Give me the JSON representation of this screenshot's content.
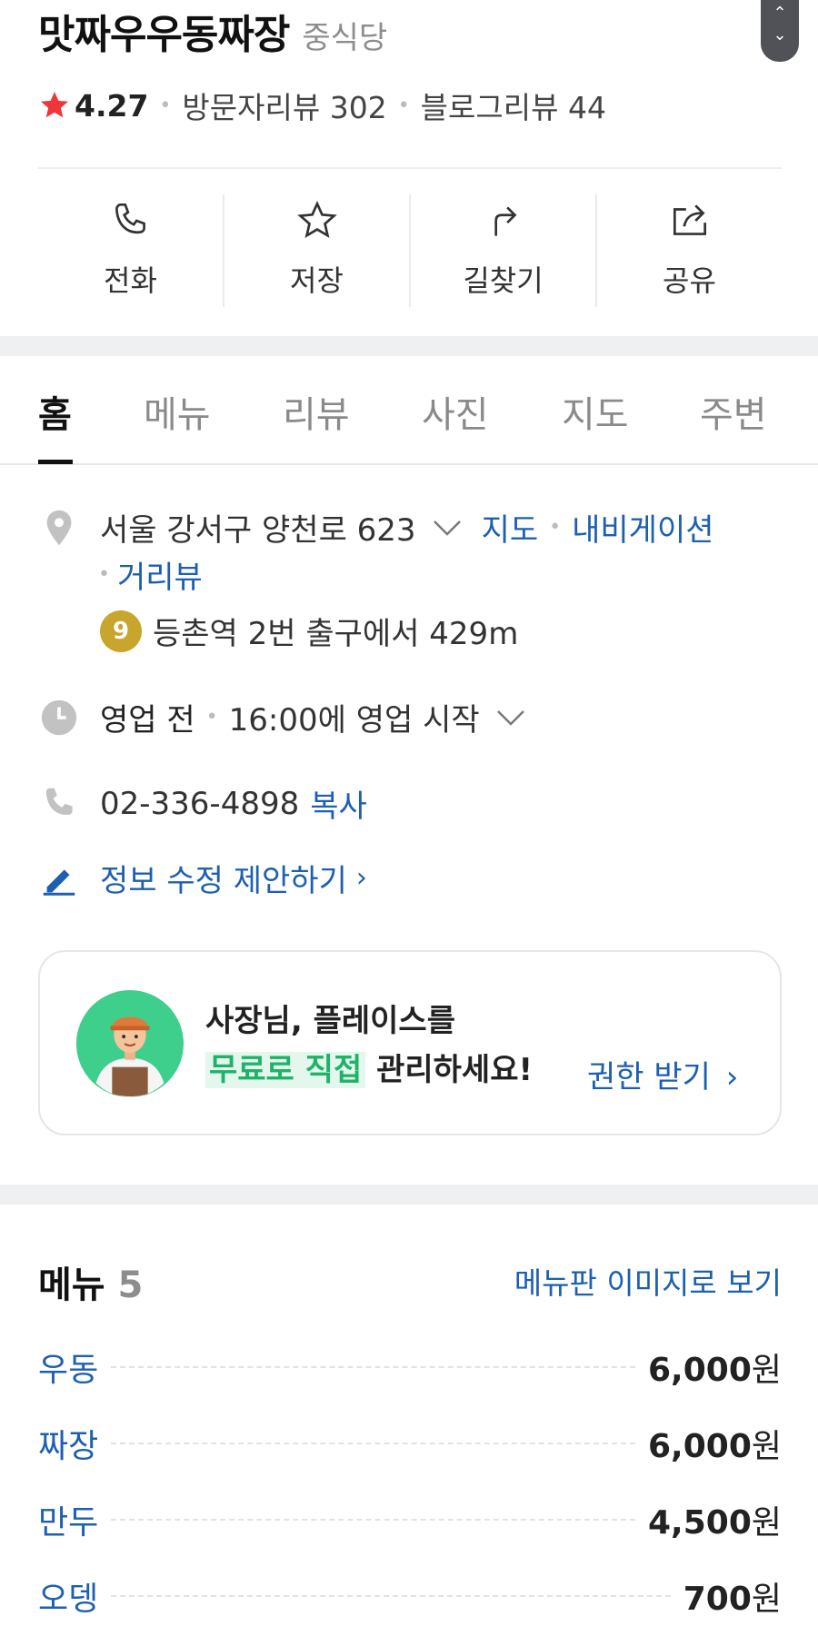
{
  "place": {
    "name": "맛짜우우동짜장",
    "category": "중식당",
    "rating": "4.27",
    "visitor_reviews": "방문자리뷰 302",
    "blog_reviews": "블로그리뷰 44"
  },
  "actions": [
    {
      "label": "전화",
      "icon": "phone-icon"
    },
    {
      "label": "저장",
      "icon": "star-outline-icon"
    },
    {
      "label": "길찾기",
      "icon": "directions-icon"
    },
    {
      "label": "공유",
      "icon": "share-icon"
    }
  ],
  "tabs": [
    "홈",
    "메뉴",
    "리뷰",
    "사진",
    "지도",
    "주변"
  ],
  "active_tab": "홈",
  "info": {
    "address": "서울 강서구 양천로 623",
    "map_link": "지도",
    "navigation_link": "내비게이션",
    "street_view_link": "거리뷰",
    "subway_line": "9",
    "subway_text": "등촌역 2번 출구에서 429m",
    "hours_status": "영업 전",
    "hours_text": "16:00에 영업 시작",
    "phone": "02-336-4898",
    "copy_label": "복사",
    "suggest_edit": "정보 수정 제안하기"
  },
  "promo": {
    "line1": "사장님, 플레이스를",
    "highlight": "무료로 직접",
    "line2_rest": " 관리하세요!",
    "link": "권한 받기"
  },
  "menu": {
    "title": "메뉴",
    "count": "5",
    "image_link": "메뉴판 이미지로 보기",
    "items": [
      {
        "name": "우동",
        "price": "6,000",
        "unit": "원"
      },
      {
        "name": "짜장",
        "price": "6,000",
        "unit": "원"
      },
      {
        "name": "만두",
        "price": "4,500",
        "unit": "원"
      },
      {
        "name": "오뎅",
        "price": "700",
        "unit": "원"
      }
    ]
  },
  "colors": {
    "link_blue": "#1d5fb0",
    "star_red": "#f0353b",
    "subway_line9": "#c8a52c",
    "promo_green": "#1eb369"
  }
}
